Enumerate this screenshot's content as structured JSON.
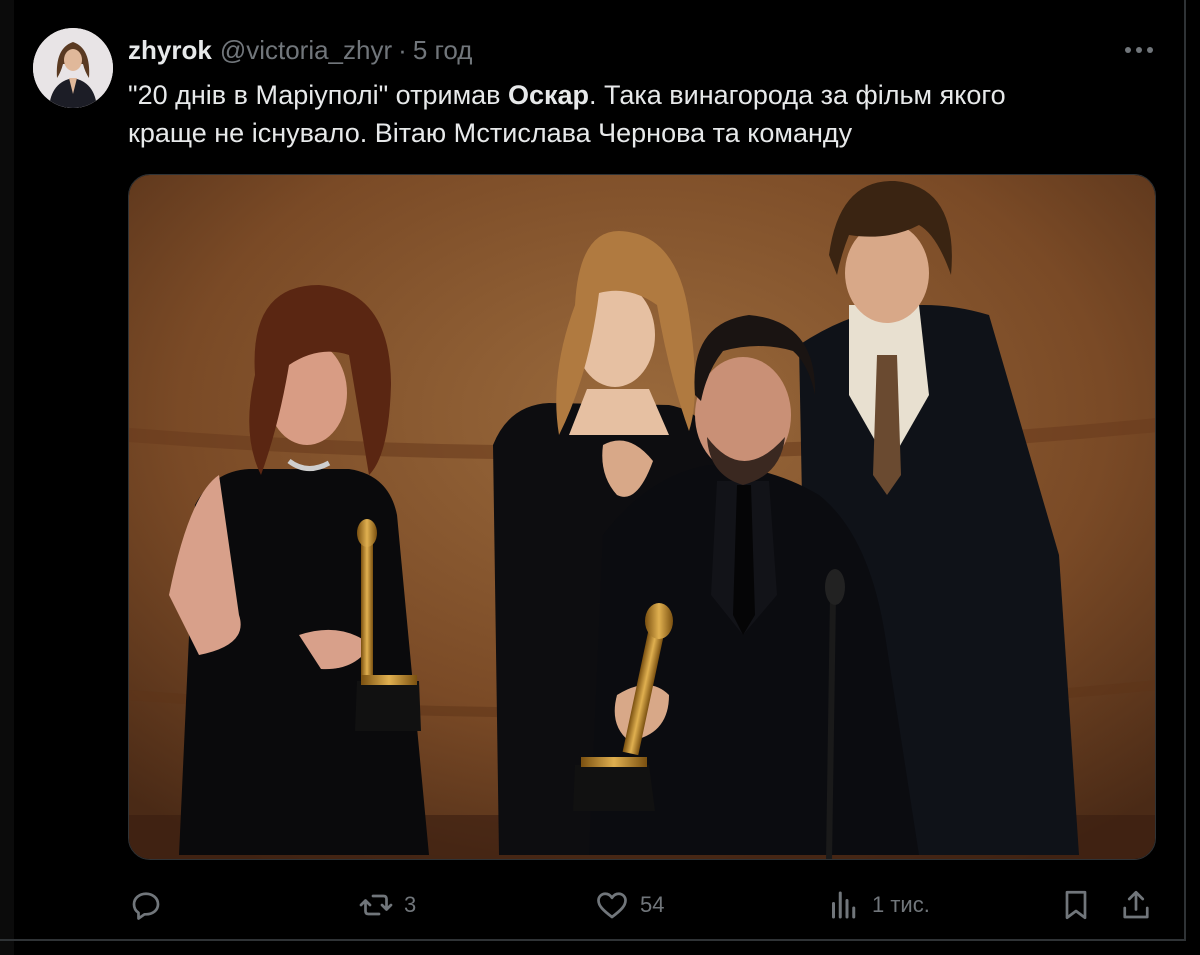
{
  "tweet": {
    "display_name": "zhyrok",
    "handle": "@victoria_zhyr",
    "separator": "·",
    "time": "5 год",
    "text_line1_a": "\"20 днів в Маріуполі\" отримав ",
    "text_bold": "Оскар",
    "text_line1_b": ". Така винагорода за фільм якого",
    "text_line2": "краще не існувало. Вітаю Мстислава Чернова та команду"
  },
  "actions": {
    "reply_count": "",
    "retweet_count": "3",
    "like_count": "54",
    "views_count": "1 тис."
  },
  "icons": {
    "more": "more-icon",
    "reply": "reply-icon",
    "retweet": "retweet-icon",
    "like": "heart-icon",
    "views": "views-icon",
    "bookmark": "bookmark-icon",
    "share": "share-icon"
  },
  "colors": {
    "background": "#000000",
    "text": "#e7e9ea",
    "secondary": "#71767b",
    "stage_bg": "#7a4a26"
  }
}
